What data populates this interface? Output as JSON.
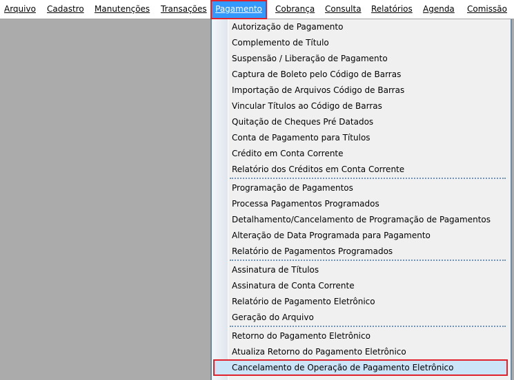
{
  "menubar": {
    "items": [
      {
        "label": "Arquivo"
      },
      {
        "label": "Cadastro"
      },
      {
        "label": "Manutenções"
      },
      {
        "label": "Transações"
      },
      {
        "label": "Pagamento"
      },
      {
        "label": "Cobrança"
      },
      {
        "label": "Consulta"
      },
      {
        "label": "Relatórios"
      },
      {
        "label": "Agenda"
      },
      {
        "label": "Comissão"
      }
    ]
  },
  "dropdown": {
    "groups": [
      {
        "items": [
          {
            "label": "Autorização de Pagamento"
          },
          {
            "label": "Complemento de Título"
          },
          {
            "label": "Suspensão / Liberação de Pagamento"
          },
          {
            "label": "Captura de Boleto pelo Código de Barras"
          },
          {
            "label": "Importação de Arquivos Código de Barras"
          },
          {
            "label": "Vincular Títulos ao Código de Barras"
          },
          {
            "label": "Quitação de Cheques Pré Datados"
          },
          {
            "label": "Conta de Pagamento para Títulos"
          },
          {
            "label": "Crédito em Conta Corrente"
          },
          {
            "label": "Relatório dos Créditos em Conta Corrente"
          }
        ]
      },
      {
        "items": [
          {
            "label": "Programação de Pagamentos"
          },
          {
            "label": "Processa Pagamentos Programados"
          },
          {
            "label": "Detalhamento/Cancelamento de Programação de Pagamentos"
          },
          {
            "label": "Alteração de Data Programada para Pagamento"
          },
          {
            "label": "Relatório de Pagamentos Programados"
          }
        ]
      },
      {
        "items": [
          {
            "label": "Assinatura de Títulos"
          },
          {
            "label": "Assinatura de Conta Corrente"
          },
          {
            "label": "Relatório de Pagamento Eletrônico"
          },
          {
            "label": "Geração do Arquivo"
          }
        ]
      },
      {
        "items": [
          {
            "label": "Retorno do Pagamento Eletrônico"
          },
          {
            "label": "Atualiza Retorno do Pagamento Eletrônico"
          },
          {
            "label": "Cancelamento de Operação de Pagamento Eletrônico"
          }
        ]
      }
    ]
  }
}
